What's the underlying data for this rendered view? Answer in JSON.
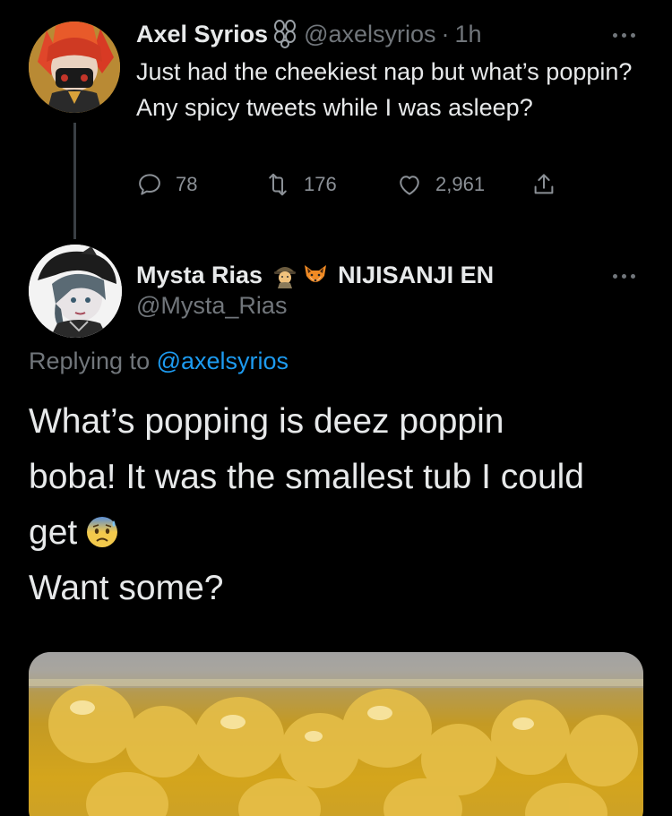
{
  "tweet1": {
    "display_name": "Axel Syrios",
    "badge_icon": "chain-link-icon",
    "handle": "@axelsyrios",
    "separator": "·",
    "time": "1h",
    "text": "Just had the cheekiest nap but what’s poppin? Any spicy tweets while I was asleep?",
    "actions": {
      "replies": "78",
      "retweets": "176",
      "likes": "2,961"
    }
  },
  "reply": {
    "display_name": "Mysta Rias",
    "badges": [
      "detective-emoji-icon",
      "fox-emoji-icon"
    ],
    "affiliation": "NIJISANJI EN",
    "handle": "@Mysta_Rias",
    "replying_prefix": "Replying to",
    "replying_to": "@axelsyrios",
    "body_line1": "What’s popping is deez poppin",
    "body_line2": "boba! It was the smallest tub I could",
    "body_line3": "get",
    "body_line4": "Want some?",
    "inline_emoji": "anxious-sweat-emoji-icon"
  },
  "colors": {
    "background": "#000000",
    "text": "#e7e9ea",
    "muted": "#71767b",
    "link": "#1d9bf0"
  }
}
